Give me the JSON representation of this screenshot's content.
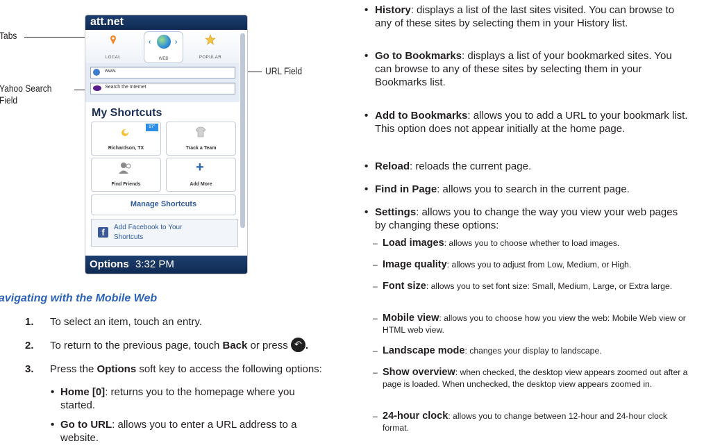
{
  "callouts": {
    "tabs": "Tabs",
    "yahoo_line1": "Yahoo Search",
    "yahoo_line2": "Field",
    "url": "URL Field"
  },
  "phone": {
    "title": "att.net",
    "tabs": [
      {
        "label": "LOCAL"
      },
      {
        "label": "WEB"
      },
      {
        "label": "POPULAR"
      }
    ],
    "url_field": "www.",
    "search_placeholder": "Search the Internet",
    "shortcuts_title": "My Shortcuts",
    "weather_badge": "97°",
    "tiles": [
      {
        "label": "Richardson, TX"
      },
      {
        "label": "Track a Team"
      },
      {
        "label": "Find Friends"
      },
      {
        "label": "Add More"
      }
    ],
    "manage_label": "Manage Shortcuts",
    "facebook_text": "Add Facebook to Your Shortcuts",
    "bottom_left": "Options",
    "bottom_time": "3:32 PM"
  },
  "left": {
    "heading": "avigating with the Mobile Web",
    "steps": [
      {
        "num": "1.",
        "text": "To select an item, touch an entry."
      },
      {
        "num": "2.",
        "pre": "To return to the previous page, touch ",
        "bold": "Back",
        "post": " or press",
        "end": "."
      },
      {
        "num": "3.",
        "pre": "Press the ",
        "bold": "Options",
        "post": " soft key to access the following options:"
      }
    ],
    "bullets": [
      {
        "term": "Home [0]",
        "text": ": returns you to the homepage where you",
        "cont": "started."
      },
      {
        "term": "Go to URL",
        "text": ": allows you to enter a URL address to a",
        "cont": "website."
      }
    ]
  },
  "right": {
    "bullets": [
      {
        "term": "History",
        "text": ": displays a list of the last sites visited. You can browse to any of these sites by selecting them in your History list."
      },
      {
        "term": "Go to Bookmarks",
        "text": ": displays a list of your bookmarked sites. You can browse to any of these sites by selecting them in your Bookmarks list."
      },
      {
        "term": "Add to Bookmarks",
        "text": ": allows you to add a URL to your bookmark list. This option does not appear initially at the home page."
      },
      {
        "term": "Reload",
        "text": ": reloads the current page."
      },
      {
        "term": "Find in Page",
        "text": ": allows you to search in the current page."
      },
      {
        "term": "Settings",
        "text": ": allows you to change the way you view your web pages by changing these options:"
      }
    ],
    "subs": [
      {
        "term": "Load images",
        "text": ": allows you to choose whether to load images."
      },
      {
        "term": "Image quality",
        "text": ": allows you to adjust from Low, Medium, or High."
      },
      {
        "term": "Font size",
        "text": ": allows you to set font size: Small, Medium, Large, or Extra large."
      },
      {
        "term": "Mobile view",
        "text": ": allows you to choose how you view the web: Mobile Web view or HTML web view."
      },
      {
        "term": "Landscape mode",
        "text": ": changes your display to landscape."
      },
      {
        "term": "Show overview",
        "text": ": when checked, the desktop view appears zoomed out after a page is loaded. When unchecked, the desktop view appears zoomed in."
      },
      {
        "term": "24-hour clock",
        "text": ": allows you to change between 12-hour and 24-hour clock format."
      }
    ]
  }
}
